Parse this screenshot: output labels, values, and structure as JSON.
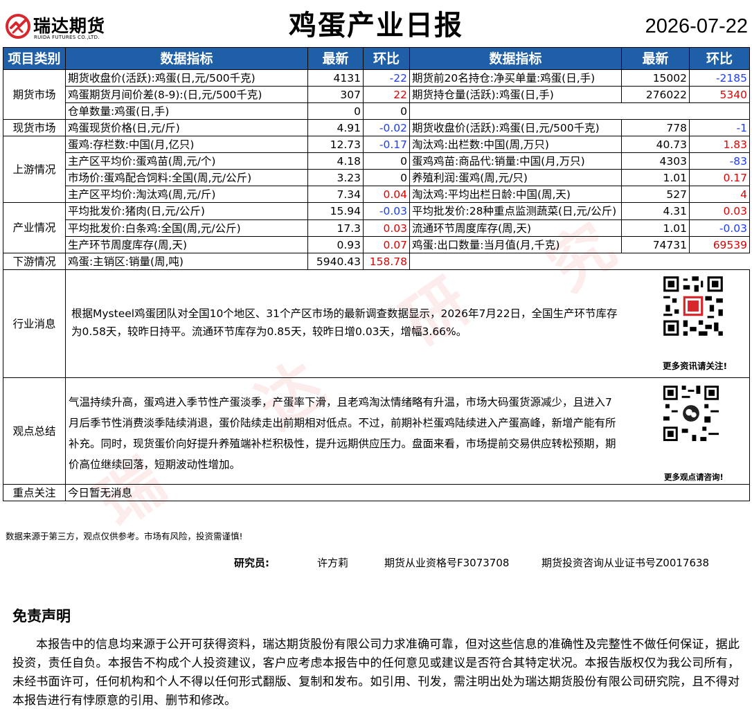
{
  "header": {
    "logo_cn": "瑞达期货",
    "logo_en": "RUIDA FUTURES CO.,LTD.",
    "title": "鸡蛋产业日报",
    "date": "2026-07-22"
  },
  "table_head": {
    "category": "项目类别",
    "indicator": "数据指标",
    "latest": "最新",
    "change": "环比",
    "indicator2": "数据指标",
    "latest2": "最新",
    "change2": "环比"
  },
  "sections": {
    "futures": "期货市场",
    "spot": "现货市场",
    "upstream": "上游情况",
    "industry": "产业情况",
    "downstream": "下游情况"
  },
  "rows": [
    {
      "l_name": "期货收盘价(活跃):鸡蛋(日,元/500千克)",
      "l_val": "4131",
      "l_chg": "-22",
      "r_name": "期货前20名持仓:净买单量:鸡蛋(日,手)",
      "r_val": "15002",
      "r_chg": "-2185"
    },
    {
      "l_name": "鸡蛋期货月间价差(8-9):(日,元/500千克)",
      "l_val": "307",
      "l_chg": "22",
      "r_name": "期货持仓量(活跃):鸡蛋(日,手)",
      "r_val": "276022",
      "r_chg": "5340"
    },
    {
      "l_name": "仓单数量:鸡蛋(日,手)",
      "l_val": "0",
      "l_chg": "0",
      "r_name": "",
      "r_val": "",
      "r_chg": ""
    },
    {
      "l_name": "鸡蛋现货价格(日,元/斤)",
      "l_val": "4.91",
      "l_chg": "-0.02",
      "r_name": "期货收盘价(活跃):鸡蛋(日,元/500千克)",
      "r_val": "778",
      "r_chg": "-1"
    },
    {
      "l_name": "蛋鸡:存栏数:中国(月,亿只)",
      "l_val": "12.73",
      "l_chg": "-0.17",
      "r_name": "淘汰鸡:出栏数:中国(周,万只)",
      "r_val": "40.73",
      "r_chg": "1.83"
    },
    {
      "l_name": "主产区平均价:蛋鸡苗(周,元/个)",
      "l_val": "4.18",
      "l_chg": "0",
      "r_name": "蛋鸡鸡苗:商品代:销量:中国(月,万只)",
      "r_val": "4303",
      "r_chg": "-83"
    },
    {
      "l_name": "市场价:蛋鸡配合饲料:全国(周,元/公斤)",
      "l_val": "3.23",
      "l_chg": "0",
      "r_name": "养殖利润:蛋鸡(周,元/只)",
      "r_val": "1.01",
      "r_chg": "0.17"
    },
    {
      "l_name": "主产区平均价:淘汰鸡(周,元/斤)",
      "l_val": "7.34",
      "l_chg": "0.04",
      "r_name": "淘汰鸡:平均出栏日龄:中国(周,天)",
      "r_val": "527",
      "r_chg": "4"
    },
    {
      "l_name": "平均批发价:猪肉(日,元/公斤)",
      "l_val": "15.94",
      "l_chg": "-0.03",
      "r_name": "平均批发价:28种重点监测蔬菜(日,元/公斤)",
      "r_val": "4.31",
      "r_chg": "0.03"
    },
    {
      "l_name": "平均批发价:白条鸡:全国(周,元/公斤)",
      "l_val": "17.3",
      "l_chg": "0.03",
      "r_name": "流通环节周度库存(周,天)",
      "r_val": "1.01",
      "r_chg": "-0.03"
    },
    {
      "l_name": "生产环节周度库存(周,天)",
      "l_val": "0.93",
      "l_chg": "0.07",
      "r_name": "鸡蛋:出口数量:当月值(月,千克)",
      "r_val": "74731",
      "r_chg": "69539"
    },
    {
      "l_name": "鸡蛋:主销区:销量(周,吨)",
      "l_val": "5940.43",
      "l_chg": "158.78",
      "r_name": "",
      "r_val": "",
      "r_chg": ""
    }
  ],
  "news": {
    "label": "行业消息",
    "text": "根据Mysteel鸡蛋团队对全国10个地区、31个产区市场的最新调查数据显示，2026年7月22日，全国生产环节库存为0.58天，较昨日持平。流通环节库存为0.85天，较昨日增0.03天，增幅3.66%。",
    "qr_caption": "更多资讯请关注!"
  },
  "view": {
    "label": "观点总结",
    "text": "气温持续升高，蛋鸡进入季节性产蛋淡季，产蛋率下滑，且老鸡淘汰情绪略有升温，市场大码蛋货源减少，且进入7月后季节性消费淡季陆续消退，蛋价陆续走出前期相对低点。不过，前期补栏蛋鸡陆续进入产蛋高峰，新增产能有所补充。同时，现货蛋价向好提升养殖端补栏积极性，提升远期供应压力。盘面来看，市场提前交易供应转松预期，期价高位继续回落，短期波动性增加。",
    "qr_caption": "更多观点请咨询!"
  },
  "focus": {
    "label": "重点关注",
    "text": "今日暂无消息"
  },
  "footer": {
    "source": "数据来源于第三方，观点仅供参考。市场有风险，投资需谨慎!",
    "researcher_label": "研究员:",
    "researcher_name": "许方莉",
    "license1": "期货从业资格号F3073708",
    "license2": "期货投资咨询从业证书号Z0017638"
  },
  "disclaimer": {
    "title": "免责声明",
    "body": "本报告中的信息均来源于公开可获得资料，瑞达期货股份有限公司力求准确可靠，但对这些信息的准确性及完整性不做任何保证，据此投资，责任自负。本报告不构成个人投资建议，客户应考虑本报告中的任何意见或建议是否符合其特定状况。本报告版权仅为我公司所有，未经书面许可，任何机构和个人不得以任何形式翻版、复制和发布。如引用、刊发，需注明出处为瑞达期货股份有限公司研究院，且不得对本报告进行有悖原意的引用、删节和修改。"
  },
  "watermark": [
    "瑞",
    "达",
    "研",
    "究"
  ],
  "colors": {
    "header_bg": "#1f5fa8",
    "positive": "#e00000",
    "negative": "#1a3cff",
    "logo_red": "#d7262c"
  },
  "icons": {
    "logo": "ruida-logo-icon",
    "qr1": "qr-code-icon",
    "qr2": "wechat-qr-code-icon"
  }
}
